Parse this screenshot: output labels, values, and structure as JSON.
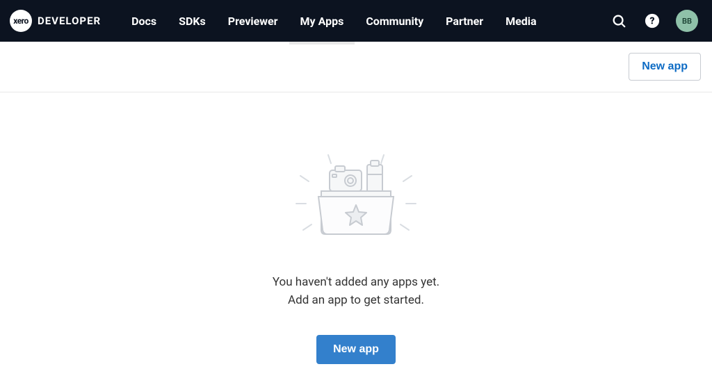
{
  "brand": {
    "logo_mark": "xero",
    "logo_text": "DEVELOPER"
  },
  "nav": [
    {
      "label": "Docs",
      "active": false
    },
    {
      "label": "SDKs",
      "active": false
    },
    {
      "label": "Previewer",
      "active": false
    },
    {
      "label": "My Apps",
      "active": true
    },
    {
      "label": "Community",
      "active": false
    },
    {
      "label": "Partner",
      "active": false
    },
    {
      "label": "Media",
      "active": false
    }
  ],
  "user": {
    "initials": "BB"
  },
  "action_bar": {
    "new_app_label": "New app"
  },
  "empty_state": {
    "line1": "You haven't added any apps yet.",
    "line2": "Add an app to get started.",
    "cta_label": "New app"
  }
}
